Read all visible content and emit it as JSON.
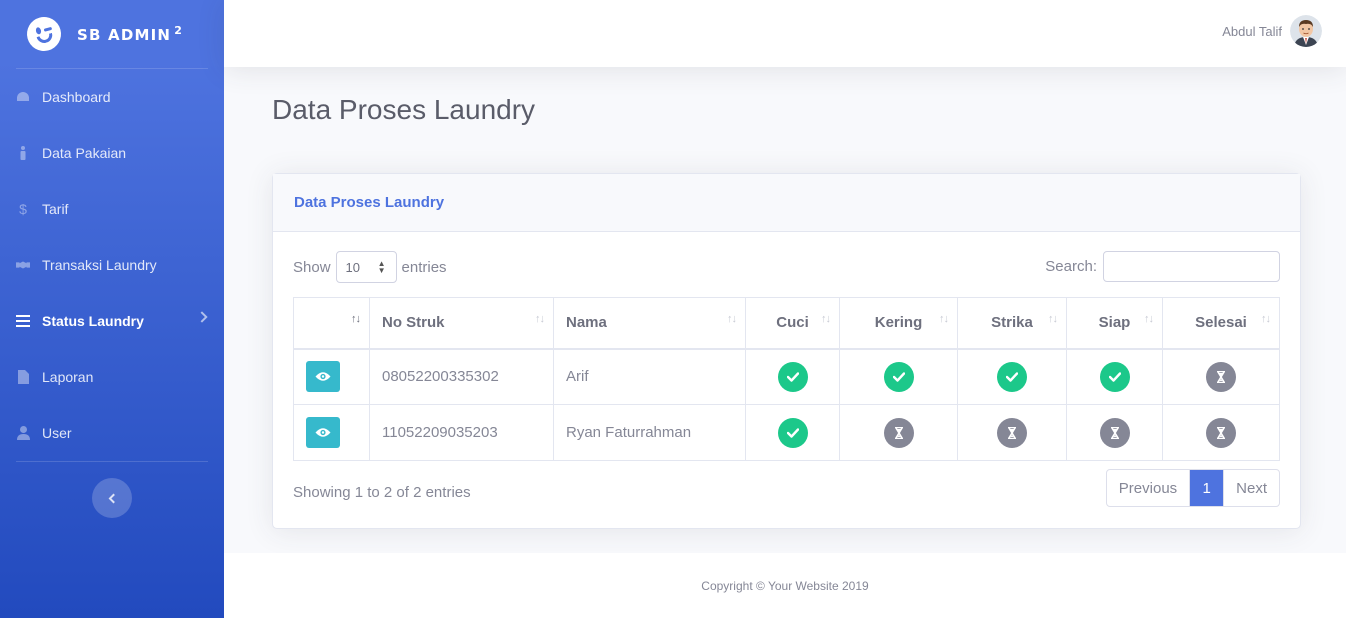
{
  "brand": {
    "name": "SB ADMIN",
    "sup": "2"
  },
  "sidebar": {
    "items": [
      {
        "label": "Dashboard",
        "icon": "tachometer-icon"
      },
      {
        "label": "Data Pakaian",
        "icon": "person-icon"
      },
      {
        "label": "Tarif",
        "icon": "dollar-icon"
      },
      {
        "label": "Transaksi Laundry",
        "icon": "handshake-icon"
      },
      {
        "label": "Status Laundry",
        "icon": "list-icon",
        "active": true
      },
      {
        "label": "Laporan",
        "icon": "file-icon"
      },
      {
        "label": "User",
        "icon": "user-icon"
      }
    ]
  },
  "topbar": {
    "user_name": "Abdul Talif"
  },
  "page": {
    "title": "Data Proses Laundry"
  },
  "card": {
    "title": "Data Proses Laundry",
    "show_label": "Show",
    "entries_value": "10",
    "entries_label": "entries",
    "search_label": "Search:",
    "search_value": ""
  },
  "table": {
    "columns": [
      "",
      "No Struk",
      "Nama",
      "Cuci",
      "Kering",
      "Strika",
      "Siap",
      "Selesai"
    ],
    "rows": [
      {
        "no_struk": "08052200335302",
        "nama": "Arif",
        "cuci": "done",
        "kering": "done",
        "strika": "done",
        "siap": "done",
        "selesai": "wait"
      },
      {
        "no_struk": "11052209035203",
        "nama": "Ryan Faturrahman",
        "cuci": "done",
        "kering": "wait",
        "strika": "wait",
        "siap": "wait",
        "selesai": "wait"
      }
    ]
  },
  "pagination": {
    "info": "Showing 1 to 2 of 2 entries",
    "previous": "Previous",
    "current": "1",
    "next": "Next"
  },
  "footer": {
    "copyright": "Copyright © Your Website 2019"
  },
  "colors": {
    "primary": "#4e73df",
    "success": "#1cc88a",
    "info": "#36b9cc",
    "secondary": "#858796"
  }
}
